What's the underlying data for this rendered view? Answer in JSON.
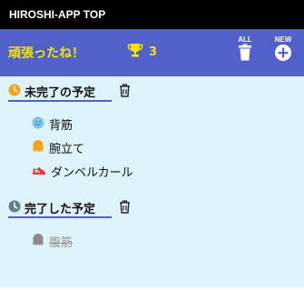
{
  "app": {
    "title": "HIROSHI-APP TOP"
  },
  "header": {
    "message": "頑張ったね！",
    "trophy_count": "3",
    "all_label": "ALL",
    "new_label": "NEW"
  },
  "sections": {
    "pending": {
      "title": "未完了の予定",
      "items": [
        {
          "label": "背筋",
          "icon": "smiley-face-icon"
        },
        {
          "label": "腕立て",
          "icon": "ghost-icon"
        },
        {
          "label": "ダンベルカール",
          "icon": "shoe-icon"
        }
      ]
    },
    "done": {
      "title": "完了した予定",
      "items": [
        {
          "label": "腹筋",
          "icon": "ghost-icon"
        }
      ]
    }
  },
  "colors": {
    "titlebar": "#000000",
    "header": "#5161c9",
    "accent_yellow": "#f6e300",
    "content_bg": "#def3fc",
    "pending_clock": "#f5a31a",
    "done_clock": "#607d8b"
  }
}
